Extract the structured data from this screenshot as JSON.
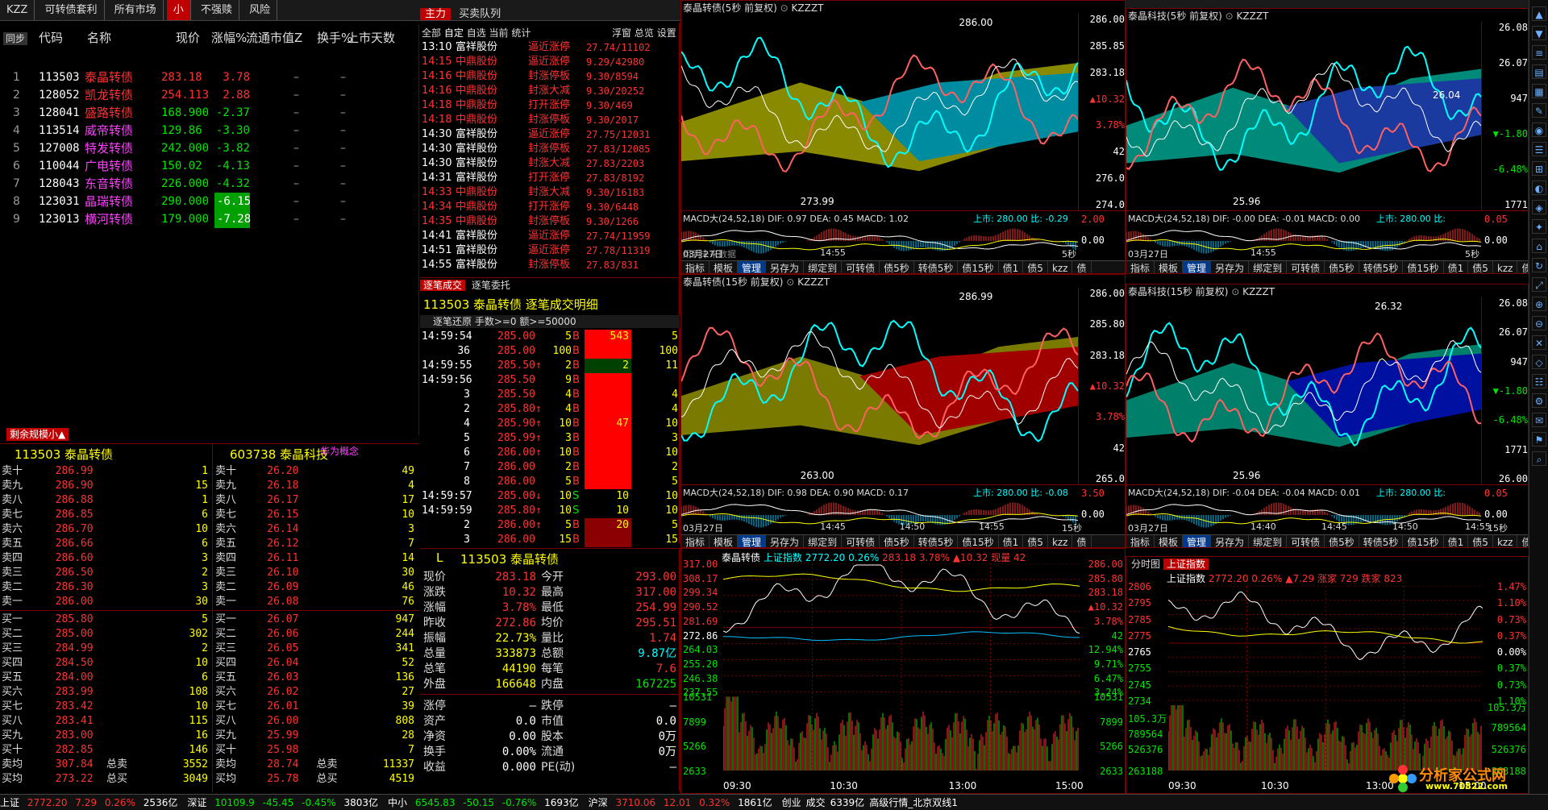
{
  "app": {
    "top_tabs": [
      "KZZ",
      "可转债套利",
      "所有市场",
      "小",
      "不强赎",
      "风险"
    ],
    "far_tabs": [
      "主力",
      "买卖队列"
    ],
    "right_tabs": [
      "分析图",
      "上证指数"
    ]
  },
  "quote_list": {
    "side_btn": "同步",
    "headers": [
      "代码",
      "名称",
      "现价",
      "涨幅%",
      "流通市值Z",
      "换手%",
      "上市天数"
    ],
    "rows": [
      {
        "idx": "1",
        "code": "113503",
        "name": "泰晶转债",
        "price": "283.18",
        "chg": "3.78",
        "c1": "–",
        "c2": "–",
        "up": true
      },
      {
        "idx": "2",
        "code": "128052",
        "name": "凯龙转债",
        "price": "254.113",
        "chg": "2.88",
        "c1": "–",
        "c2": "–",
        "up": true
      },
      {
        "idx": "3",
        "code": "128041",
        "name": "盛路转债",
        "price": "168.900",
        "chg": "-2.37",
        "c1": "–",
        "c2": "–",
        "up": false
      },
      {
        "idx": "4",
        "code": "113514",
        "name": "威帝转债",
        "price": "129.86",
        "chg": "-3.30",
        "c1": "–",
        "c2": "–",
        "up": false
      },
      {
        "idx": "5",
        "code": "127008",
        "name": "特发转债",
        "price": "242.000",
        "chg": "-3.82",
        "c1": "–",
        "c2": "–",
        "up": false
      },
      {
        "idx": "6",
        "code": "110044",
        "name": "广电转债",
        "price": "150.02",
        "chg": "-4.13",
        "c1": "–",
        "c2": "–",
        "up": false
      },
      {
        "idx": "7",
        "code": "128043",
        "name": "东音转债",
        "price": "226.000",
        "chg": "-4.32",
        "c1": "–",
        "c2": "–",
        "up": false
      },
      {
        "idx": "8",
        "code": "123031",
        "name": "晶瑞转债",
        "price": "290.000",
        "chg": "-6.15",
        "c1": "–",
        "c2": "–",
        "up": false
      },
      {
        "idx": "9",
        "code": "123013",
        "name": "横河转债",
        "price": "179.000",
        "chg": "-7.28",
        "c1": "–",
        "c2": "–",
        "up": false
      }
    ]
  },
  "remaining": {
    "label": "剩余规模小▲"
  },
  "orderbook_left": {
    "title": "113503 泰晶转债",
    "sells": [
      [
        "卖十",
        "286.99",
        "1"
      ],
      [
        "卖九",
        "286.90",
        "15"
      ],
      [
        "卖八",
        "286.88",
        "1"
      ],
      [
        "卖七",
        "286.85",
        "6"
      ],
      [
        "卖六",
        "286.70",
        "10"
      ],
      [
        "卖五",
        "286.66",
        "6"
      ],
      [
        "卖四",
        "286.60",
        "3"
      ],
      [
        "卖三",
        "286.50",
        "2"
      ],
      [
        "卖二",
        "286.30",
        "3"
      ],
      [
        "卖一",
        "286.00",
        "30"
      ]
    ],
    "buys": [
      [
        "买一",
        "285.80",
        "5"
      ],
      [
        "买二",
        "285.00",
        "302"
      ],
      [
        "买三",
        "284.99",
        "2"
      ],
      [
        "买四",
        "284.50",
        "10"
      ],
      [
        "买五",
        "284.00",
        "6"
      ],
      [
        "买六",
        "283.99",
        "108"
      ],
      [
        "买七",
        "283.42",
        "10"
      ],
      [
        "买八",
        "283.41",
        "115"
      ],
      [
        "买九",
        "283.00",
        "16"
      ],
      [
        "买十",
        "282.85",
        "146"
      ]
    ],
    "avg_sell": [
      "卖均",
      "307.84",
      "总卖",
      "3552"
    ],
    "avg_buy": [
      "买均",
      "273.22",
      "总买",
      "3049"
    ]
  },
  "orderbook_right": {
    "title": "603738 泰晶科技",
    "tag": "华为概念",
    "sells": [
      [
        "卖十",
        "26.20",
        "49"
      ],
      [
        "卖九",
        "26.18",
        "4"
      ],
      [
        "卖八",
        "26.17",
        "17"
      ],
      [
        "卖七",
        "26.15",
        "10"
      ],
      [
        "卖六",
        "26.14",
        "3"
      ],
      [
        "卖五",
        "26.12",
        "7"
      ],
      [
        "卖四",
        "26.11",
        "14"
      ],
      [
        "卖三",
        "26.10",
        "30"
      ],
      [
        "卖二",
        "26.09",
        "46"
      ],
      [
        "卖一",
        "26.08",
        "76"
      ]
    ],
    "buys": [
      [
        "买一",
        "26.07",
        "947"
      ],
      [
        "买二",
        "26.06",
        "244"
      ],
      [
        "买三",
        "26.05",
        "341"
      ],
      [
        "买四",
        "26.04",
        "52"
      ],
      [
        "买五",
        "26.03",
        "136"
      ],
      [
        "买六",
        "26.02",
        "27"
      ],
      [
        "买七",
        "26.01",
        "39"
      ],
      [
        "买八",
        "26.00",
        "808"
      ],
      [
        "买九",
        "25.99",
        "28"
      ],
      [
        "买十",
        "25.98",
        "7"
      ]
    ],
    "avg_sell": [
      "卖均",
      "28.74",
      "总卖",
      "11337"
    ],
    "avg_buy": [
      "买均",
      "25.78",
      "总买",
      "4519"
    ]
  },
  "alerts": {
    "tabs": [
      "全部",
      "自定",
      "自选",
      "当前",
      "统计"
    ],
    "right_tabs": [
      "浮窗",
      "总览",
      "设置"
    ],
    "rows": [
      [
        "13:10",
        "富祥股份",
        "逼近涨停",
        "27.74/11102"
      ],
      [
        "14:15",
        "中鼎股份",
        "逼近涨停",
        "9.29/42980"
      ],
      [
        "14:16",
        "中鼎股份",
        "封涨停板",
        "9.30/8594"
      ],
      [
        "14:16",
        "中鼎股份",
        "封涨大减",
        "9.30/20252"
      ],
      [
        "14:18",
        "中鼎股份",
        "打开涨停",
        "9.30/469"
      ],
      [
        "14:18",
        "中鼎股份",
        "封涨停板",
        "9.30/2017"
      ],
      [
        "14:30",
        "富祥股份",
        "逼近涨停",
        "27.75/12031"
      ],
      [
        "14:30",
        "富祥股份",
        "封涨停板",
        "27.83/12085"
      ],
      [
        "14:30",
        "富祥股份",
        "封涨大减",
        "27.83/2203"
      ],
      [
        "14:31",
        "富祥股份",
        "打开涨停",
        "27.83/8192"
      ],
      [
        "14:33",
        "中鼎股份",
        "封涨大减",
        "9.30/16183"
      ],
      [
        "14:34",
        "中鼎股份",
        "打开涨停",
        "9.30/6448"
      ],
      [
        "14:35",
        "中鼎股份",
        "封涨停板",
        "9.30/1266"
      ],
      [
        "14:41",
        "富祥股份",
        "逼近涨停",
        "27.74/11959"
      ],
      [
        "14:51",
        "富祥股份",
        "逼近涨停",
        "27.78/11319"
      ],
      [
        "14:55",
        "富祥股份",
        "封涨停板",
        "27.83/831"
      ]
    ]
  },
  "ticks": {
    "tabs": [
      "逐笔成交",
      "逐笔委托"
    ],
    "title": "113503 泰晶转债 逐笔成交明细",
    "filter": "逐笔还原  手数>=0 额>=50000",
    "rows": [
      [
        "14:59:54",
        "285.00",
        "5",
        "B",
        "543",
        "5"
      ],
      [
        "36",
        "285.00",
        "100",
        "B",
        "",
        "100"
      ],
      [
        "14:59:55",
        "285.50↑",
        "2",
        "B",
        "2",
        "11"
      ],
      [
        "14:59:56",
        "285.50",
        "9",
        "B",
        "",
        ""
      ],
      [
        "3",
        "285.50",
        "4",
        "B",
        "",
        "4"
      ],
      [
        "2",
        "285.80↑",
        "4",
        "B",
        "",
        "4"
      ],
      [
        "4",
        "285.90↑",
        "10",
        "B",
        "47",
        "10"
      ],
      [
        "5",
        "285.99↑",
        "3",
        "B",
        "",
        "3"
      ],
      [
        "6",
        "286.00↑",
        "10",
        "B",
        "",
        "10"
      ],
      [
        "7",
        "286.00",
        "2",
        "B",
        "",
        "2"
      ],
      [
        "8",
        "286.00",
        "5",
        "B",
        "",
        "5"
      ],
      [
        "14:59:57",
        "285.00↓",
        "10",
        "S",
        "10",
        "10"
      ],
      [
        "14:59:59",
        "285.80↑",
        "10",
        "S",
        "10",
        "10"
      ],
      [
        "2",
        "286.00↑",
        "5",
        "B",
        "20",
        "5"
      ],
      [
        "3",
        "286.00",
        "15",
        "B",
        "",
        "15"
      ]
    ]
  },
  "detail": {
    "label": "L",
    "title": "113503 泰晶转债",
    "rows": [
      [
        "现价",
        "283.18",
        "今开",
        "293.00"
      ],
      [
        "涨跌",
        "10.32",
        "最高",
        "317.00"
      ],
      [
        "涨幅",
        "3.78%",
        "最低",
        "254.99"
      ],
      [
        "昨收",
        "272.86",
        "均价",
        "295.51"
      ],
      [
        "振幅",
        "22.73%",
        "量比",
        "1.74"
      ],
      [
        "总量",
        "333873",
        "总额",
        "9.87亿"
      ],
      [
        "总笔",
        "44190",
        "每笔",
        "7.6"
      ],
      [
        "外盘",
        "166648",
        "内盘",
        "167225"
      ]
    ],
    "rows2": [
      [
        "涨停",
        "–",
        "跌停",
        "–"
      ],
      [
        "资产",
        "0.0",
        "市值",
        "0.0"
      ],
      [
        "净资",
        "0.00",
        "股本",
        "0万"
      ],
      [
        "换手",
        "0.00%",
        "流通",
        "0万"
      ],
      [
        "收益",
        "0.000",
        "PE(动)",
        "–"
      ]
    ]
  },
  "charts": {
    "c1": {
      "title": "泰晶转债(5秒 前复权)",
      "sub": "KZZZT",
      "hi": "286.00",
      "lo": "273.99",
      "axis": [
        "286.00",
        "285.85",
        "283.18",
        "▲10.32",
        "3.78%",
        "42",
        "276.0",
        "274.0"
      ],
      "macd": "MACD大(24,52,18)  DIF: 0.97  DEA: 0.45  MACD: 1.02",
      "macd_r": "上市: 280.00  比: -0.29",
      "macd_axis": [
        "2.00",
        "0.00"
      ],
      "note": "用到未来数据",
      "date": "03月27日",
      "t2": "14:55",
      "t3": "5秒"
    },
    "c2": {
      "title": "泰晶科技(5秒 前复权)",
      "sub": "KZZZT",
      "hi": "",
      "lo": "25.96",
      "axis": [
        "26.08",
        "26.07",
        "947",
        "▼-1.80",
        "-6.48%",
        "1771"
      ],
      "mid": "26.04",
      "macd": "MACD大(24,52,18)  DIF: -0.00  DEA: -0.01  MACD: 0.00",
      "macd_r": "上市: 280.00  比:",
      "macd_axis": [
        "0.05",
        "0.00"
      ],
      "date": "03月27日",
      "t2": "14:55",
      "t3": "5秒"
    },
    "c3": {
      "title": "泰晶转债(15秒 前复权)",
      "sub": "KZZZT",
      "hi": "286.99",
      "lo": "263.00",
      "axis": [
        "286.00",
        "285.80",
        "283.18",
        "▲10.32",
        "3.78%",
        "42",
        "265.0"
      ],
      "macd": "MACD大(24,52,18)  DIF: 0.98  DEA: 0.90  MACD: 0.17",
      "macd_r": "上市: 280.00  比: -0.08",
      "macd_axis": [
        "3.50",
        "0.00"
      ],
      "date": "03月27日",
      "t2": "14:45",
      "t3": "14:50",
      "t4": "14:55",
      "t5": "15秒"
    },
    "c4": {
      "title": "泰晶科技(15秒 前复权)",
      "sub": "KZZZT",
      "hi": "26.32",
      "lo": "25.96",
      "axis": [
        "26.08",
        "26.07",
        "947",
        "▼-1.80",
        "-6.48%",
        "1771",
        "26.00"
      ],
      "macd": "MACD大(24,52,18)  DIF: -0.04  DEA: -0.04  MACD: 0.01",
      "macd_r": "上市: 280.00  比:",
      "macd_axis": [
        "0.05",
        "0.00"
      ],
      "date": "03月27日",
      "t2": "14:40",
      "t3": "14:45",
      "t4": "14:50",
      "t5": "14:55",
      "t6": "15秒"
    },
    "c5": {
      "title": "泰晶转债",
      "sub": "上证指数",
      "info": "2772.20 0.26%",
      "info2": "283.18 3.78% ▲10.32 现量 42",
      "left_axis": [
        "317.00",
        "308.17",
        "299.34",
        "290.52",
        "281.69",
        "272.86",
        "264.03",
        "255.20",
        "246.38",
        "237.55",
        "10531",
        "7899",
        "5266",
        "2633"
      ],
      "right_axis": [
        "286.00",
        "285.80",
        "283.18",
        "▲10.32",
        "3.78%",
        "42",
        "12.94%",
        "9.71%",
        "6.47%",
        "3.24%",
        "10531",
        "7899",
        "5266",
        "2633"
      ],
      "times": [
        "09:30",
        "10:30",
        "13:00",
        "15:00"
      ]
    },
    "c6": {
      "title": "上证指数",
      "info": "2772.20 0.26% ▲7.29 涨家 729 跌家 823",
      "tabs": [
        "分时图",
        "上证指数"
      ],
      "left_axis": [
        "2806",
        "2795",
        "2785",
        "2775",
        "2765",
        "2755",
        "2745",
        "2734",
        "105.3万",
        "789564",
        "526376",
        "263188"
      ],
      "right_axis": [
        "1.47%",
        "1.10%",
        "0.73%",
        "0.37%",
        "0.00%",
        "0.37%",
        "0.73%",
        "1.10%",
        "105.3万",
        "789564",
        "526376",
        "263188"
      ],
      "times": [
        "09:30",
        "10:30",
        "13:00",
        "15:00"
      ]
    }
  },
  "chart_toolbar": [
    "指标",
    "模板",
    "管理",
    "另存为",
    "绑定到",
    "可转债",
    "债5秒",
    "转债5秒",
    "债15秒",
    "债1",
    "债5",
    "kzz",
    "债"
  ],
  "status": {
    "items": [
      [
        "上证",
        "2772.20",
        "7.29",
        "0.26%",
        "2536亿"
      ],
      [
        "深证",
        "10109.9",
        "-45.45",
        "-0.45%",
        "3803亿"
      ],
      [
        "中小",
        "6545.83",
        "-50.15",
        "-0.76%",
        "1693亿"
      ],
      [
        "沪深",
        "3710.06",
        "12.01",
        "0.32%",
        "1861亿"
      ]
    ],
    "extra": [
      "创业",
      "成交",
      "6339亿",
      "高级行情_北京双线1"
    ]
  },
  "watermark": {
    "line1": "分析家公式网",
    "line2": "www.70822.com"
  },
  "colors": {
    "up": "#ff3232",
    "down": "#00e600",
    "accent": "#c00000",
    "cyan": "#00ffff"
  }
}
